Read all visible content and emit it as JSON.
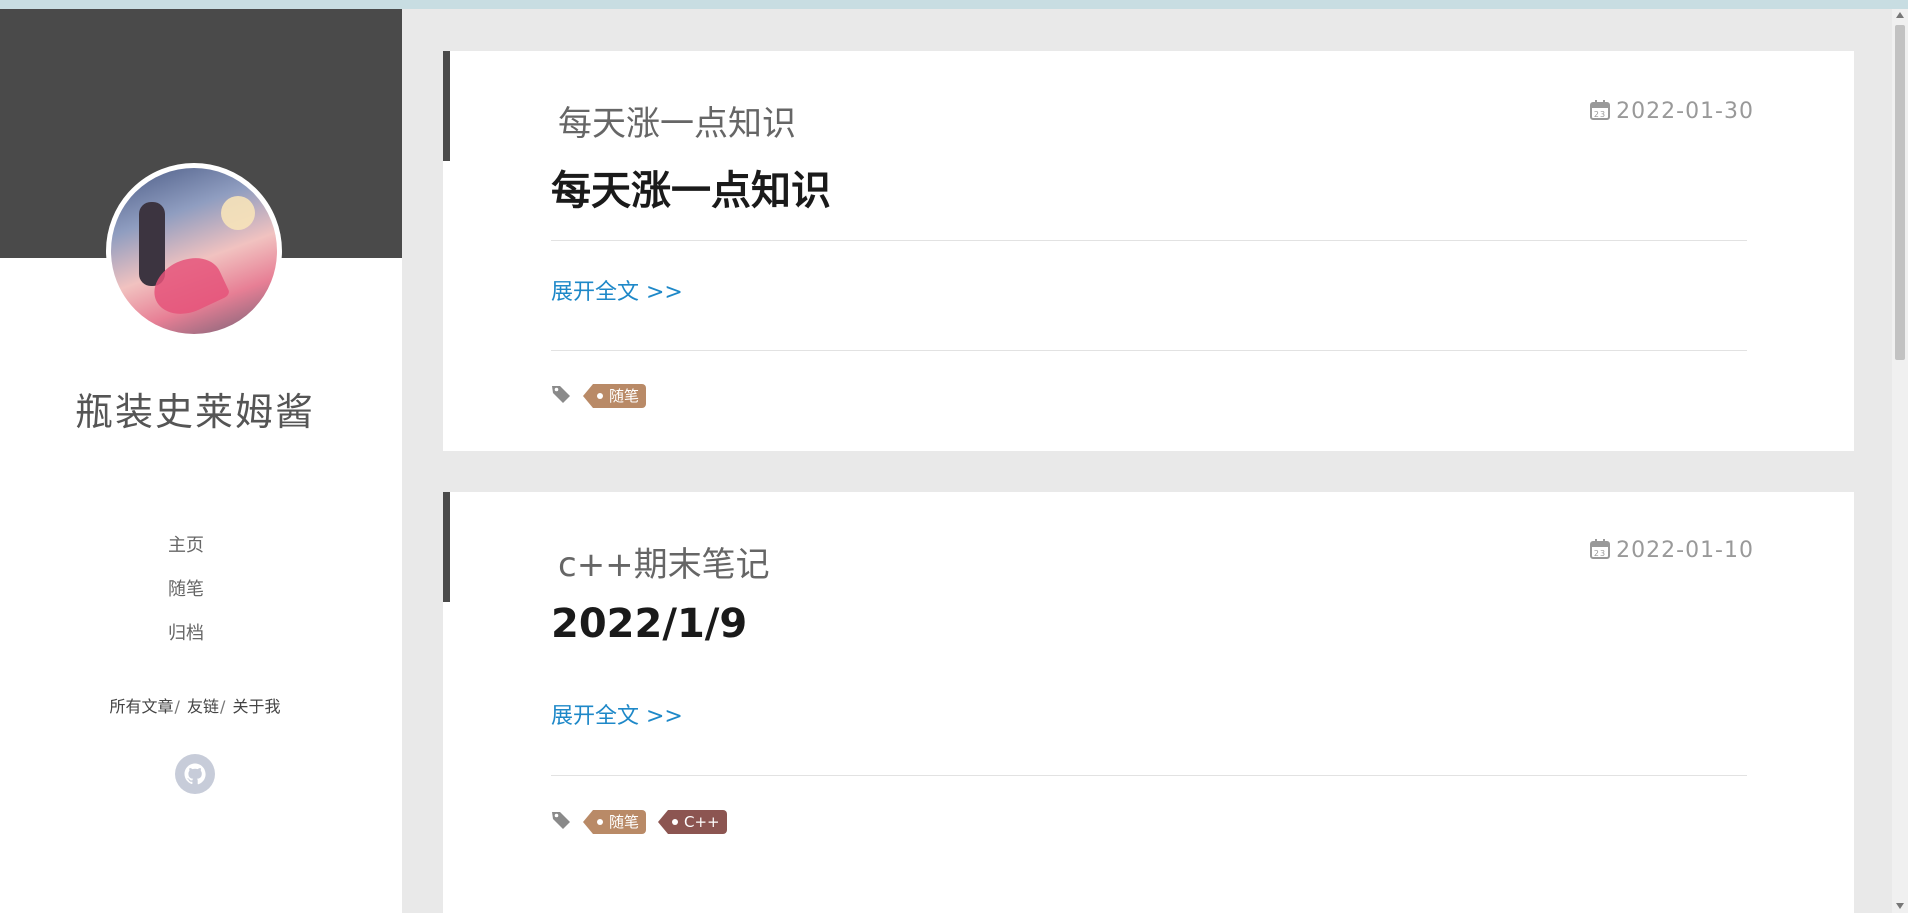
{
  "sidebar": {
    "site_title": "瓶装史莱姆酱",
    "nav": [
      {
        "label": "主页"
      },
      {
        "label": "随笔"
      },
      {
        "label": "归档"
      }
    ],
    "links": [
      {
        "label": "所有文章"
      },
      {
        "label": "友链"
      },
      {
        "label": "关于我"
      }
    ],
    "link_separator": "/",
    "social": {
      "icon": "github-icon"
    }
  },
  "posts": [
    {
      "title": "每天涨一点知识",
      "date": "2022-01-30",
      "excerpt": "每天涨一点知识",
      "read_more": "展开全文 >>",
      "tags": [
        {
          "label": "随笔",
          "color": "#b98a67"
        }
      ]
    },
    {
      "title": "c++期末笔记",
      "date": "2022-01-10",
      "excerpt": "2022/1/9",
      "read_more": "展开全文 >>",
      "tags": [
        {
          "label": "随笔",
          "color": "#b98a67"
        },
        {
          "label": "C++",
          "color": "#8c5551"
        }
      ]
    }
  ],
  "colors": {
    "accent_link": "#1e88c8",
    "banner": "#4a4a4a",
    "page_bg": "#e9e9e9"
  }
}
